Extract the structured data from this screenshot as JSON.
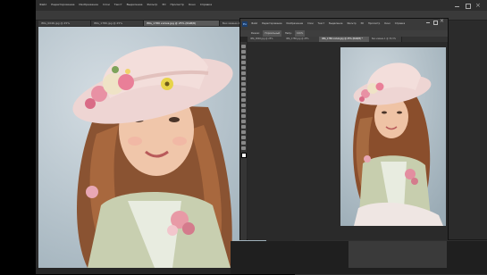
{
  "back_window": {
    "menu": [
      "Файл",
      "Редактирование",
      "Изображение",
      "Слои",
      "Текст",
      "Выделение",
      "Фильтр",
      "3D",
      "Просмотр",
      "Окно",
      "Справка"
    ],
    "tabs": [
      {
        "label": "IMG_0046.jpg @ 25%"
      },
      {
        "label": "IMG_1780.jpg @ 25%"
      },
      {
        "label": "IMG_1780 копия.jpg @ 25% (RGB/8)"
      },
      {
        "label": "Без имени-1 @ 33,3% (RGB/8)"
      }
    ]
  },
  "front_window": {
    "menu": [
      "Файл",
      "Редактирование",
      "Изображение",
      "Слои",
      "Текст",
      "Выделение",
      "Фильтр",
      "3D",
      "Просмотр",
      "Окно",
      "Справка"
    ],
    "tabs": [
      {
        "label": "IMG_0046.jpg @ 25%"
      },
      {
        "label": "IMG_1780.jpg @ 25%"
      },
      {
        "label": "IMG_1780 копия.jpg @ 25% (RGB/8) *"
      },
      {
        "label": "Без имени-1 @ 33,3%"
      }
    ],
    "options": {
      "mode_label": "Режим:",
      "mode_value": "Нормальный",
      "opacity_label": "Непр.:",
      "opacity_value": "100%"
    }
  },
  "colors": {
    "ps_bg": "#2b2b2b",
    "ps_panel": "#3c3c3c",
    "ps_menu": "#535353"
  }
}
